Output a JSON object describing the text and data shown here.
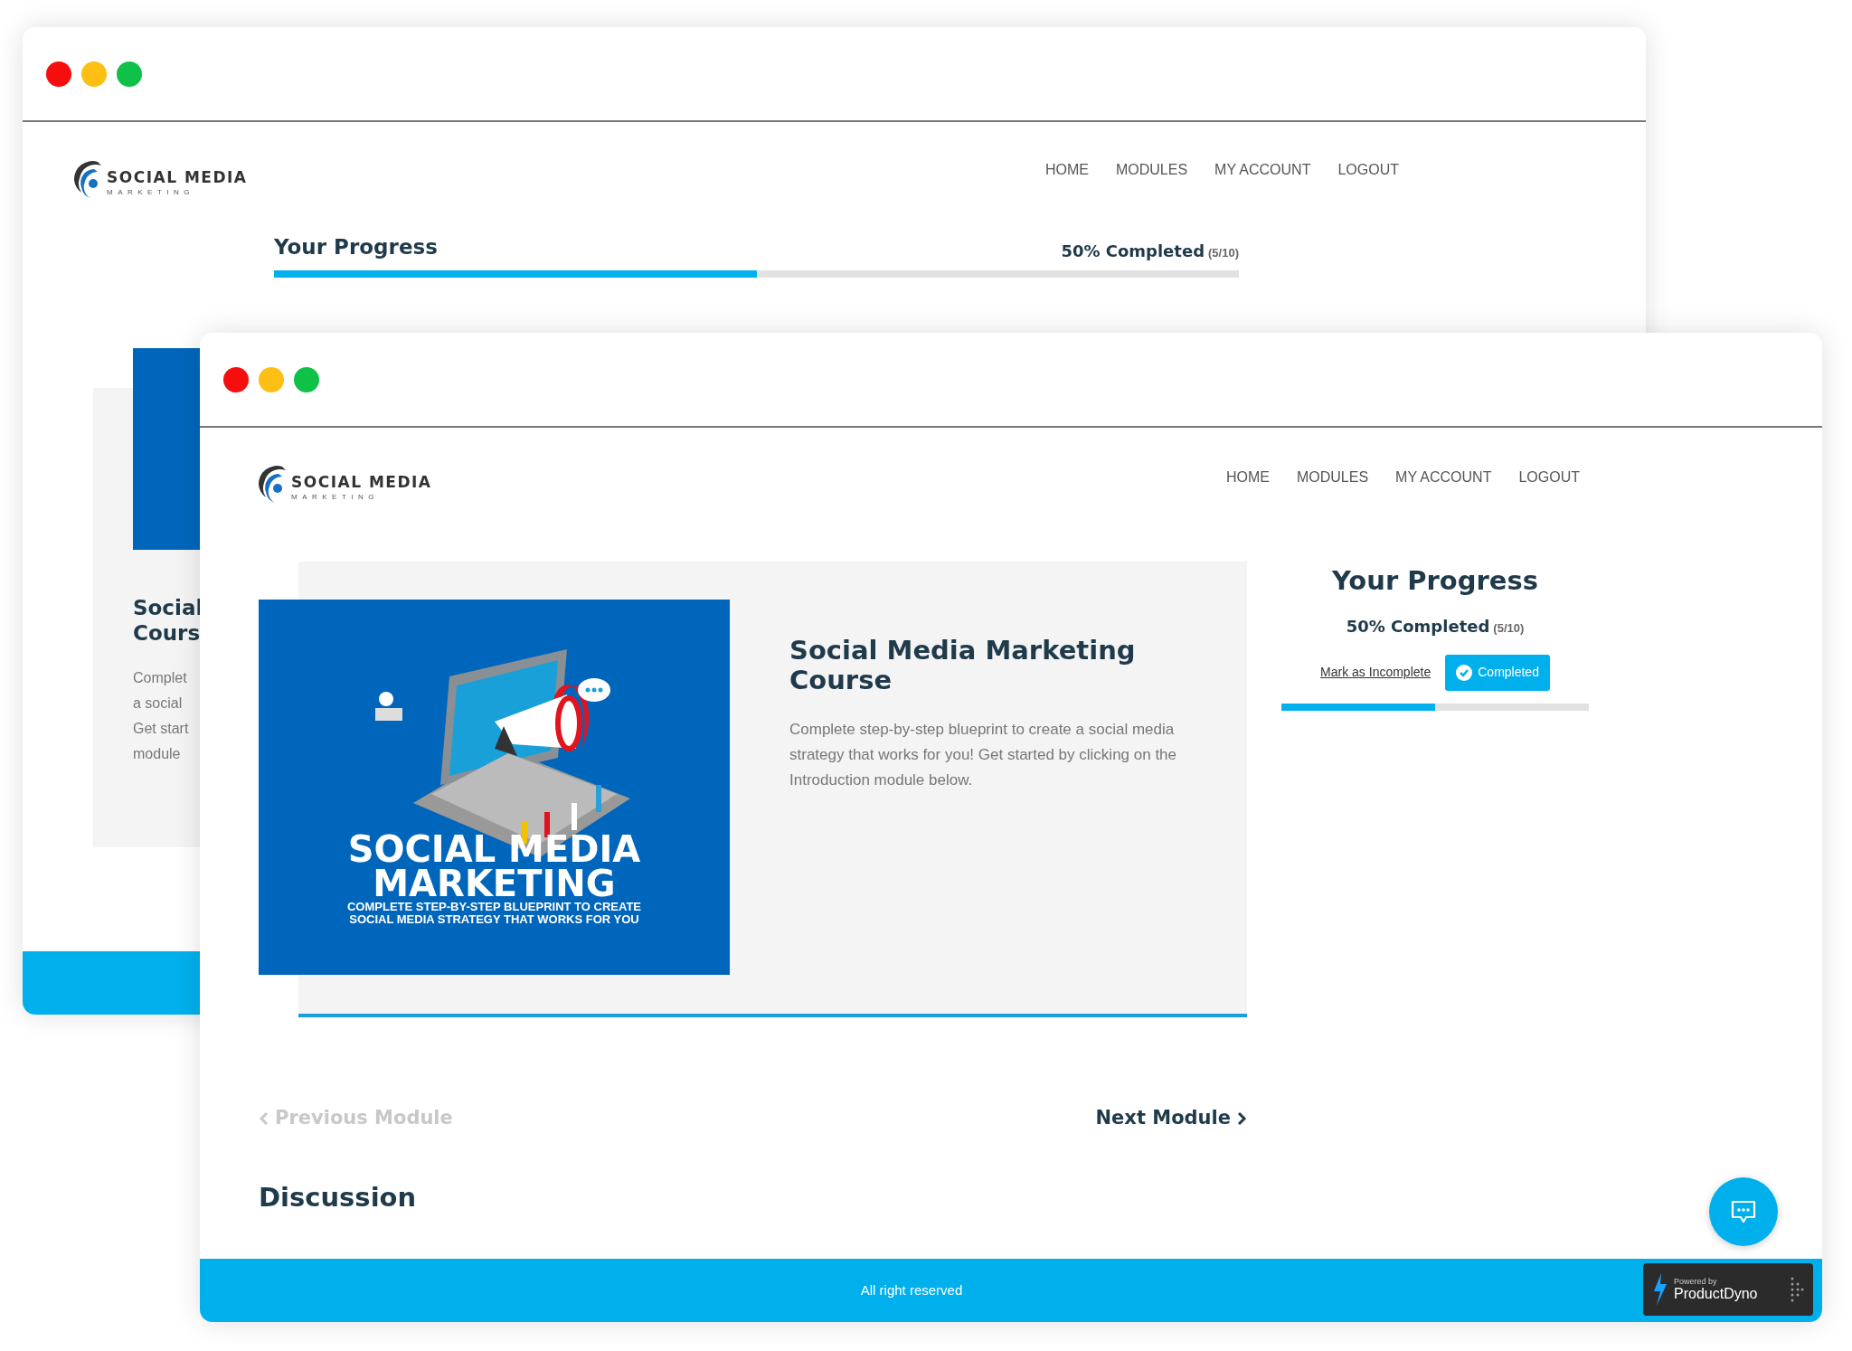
{
  "back_window": {
    "logo": {
      "name": "SOCIAL MEDIA",
      "tagline": "MARKETING"
    },
    "nav": [
      {
        "label": "HOME"
      },
      {
        "label": "MODULES"
      },
      {
        "label": "MY ACCOUNT"
      },
      {
        "label": "LOGOUT"
      }
    ],
    "progress": {
      "title": "Your Progress",
      "percent": "50% Completed",
      "count": "(5/10)",
      "level": 0.5
    },
    "course_card": {
      "title_lines": [
        "Social",
        "Cours"
      ],
      "description_lines": [
        "Complet",
        "a social",
        "Get start",
        "module"
      ]
    }
  },
  "front_window": {
    "logo": {
      "name": "SOCIAL MEDIA",
      "tagline": "MARKETING"
    },
    "nav": [
      {
        "label": "HOME"
      },
      {
        "label": "MODULES"
      },
      {
        "label": "MY ACCOUNT"
      },
      {
        "label": "LOGOUT"
      }
    ],
    "course": {
      "cover": {
        "headline": [
          "SOCIAL MEDIA",
          "MARKETING"
        ],
        "subline": [
          "COMPLETE STEP-BY-STEP BLUEPRINT TO CREATE",
          "SOCIAL MEDIA STRATEGY THAT WORKS FOR YOU"
        ]
      },
      "title": "Social Media Marketing Course",
      "description": "Complete step-by-step blueprint to create a social media strategy that works for you! Get started by clicking on the Introduction module below."
    },
    "progress": {
      "title": "Your Progress",
      "percent": "50% Completed",
      "count": "(5/10)",
      "mark_link": "Mark as Incomplete",
      "status_button": {
        "label": "Completed",
        "completed": true
      },
      "level": 0.5
    },
    "pager": {
      "previous": {
        "label": "Previous Module",
        "disabled": true
      },
      "next": {
        "label": "Next Module",
        "disabled": false
      }
    },
    "discussion_title": "Discussion",
    "footer": {
      "text": "All right reserved",
      "badge": {
        "small": "Powered by",
        "brand": "ProductDyno"
      }
    }
  }
}
